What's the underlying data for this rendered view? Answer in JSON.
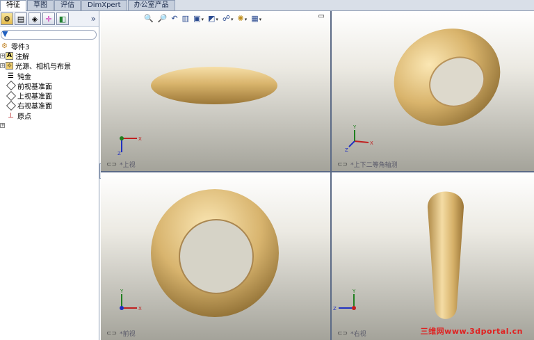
{
  "tabs": [
    {
      "label": "特征",
      "active": true
    },
    {
      "label": "草图",
      "active": false
    },
    {
      "label": "评估",
      "active": false
    },
    {
      "label": "DimXpert",
      "active": false
    },
    {
      "label": "办公室产品",
      "active": false
    }
  ],
  "panel_toolbar": {
    "icons": [
      "feature-manager-icon",
      "property-manager-icon",
      "configuration-manager-icon",
      "dimxpert-manager-icon",
      "display-manager-icon"
    ],
    "expand": "»"
  },
  "tree": {
    "root": "零件3",
    "items": [
      {
        "label": "注解",
        "icon": "annotations-icon",
        "expandable": true
      },
      {
        "label": "光源、相机与布景",
        "icon": "lights-cameras-icon",
        "expandable": true
      },
      {
        "label": "钝金",
        "icon": "material-icon",
        "expandable": false
      },
      {
        "label": "前视基准面",
        "icon": "plane-icon",
        "expandable": false
      },
      {
        "label": "上视基准面",
        "icon": "plane-icon",
        "expandable": false
      },
      {
        "label": "右视基准面",
        "icon": "plane-icon",
        "expandable": false
      },
      {
        "label": "原点",
        "icon": "origin-icon",
        "expandable": false
      }
    ]
  },
  "viewports": {
    "top_left": {
      "label": "*上视"
    },
    "top_right": {
      "label": "*上下二等角轴测"
    },
    "bottom_left": {
      "label": "*前视"
    },
    "bottom_right": {
      "label": "*右视"
    }
  },
  "view_toolbar": [
    "zoom-to-fit-icon",
    "zoom-area-icon",
    "previous-view-icon",
    "section-view-icon",
    "view-orientation-icon",
    "display-style-icon",
    "hide-show-icon",
    "edit-appearance-icon",
    "apply-scene-icon",
    "view-settings-icon"
  ],
  "watermark": "三维网www.3dportal.cn",
  "colors": {
    "part": "#d8b46e",
    "panel_bg": "#ffffff",
    "accent": "#8c9bb3"
  }
}
